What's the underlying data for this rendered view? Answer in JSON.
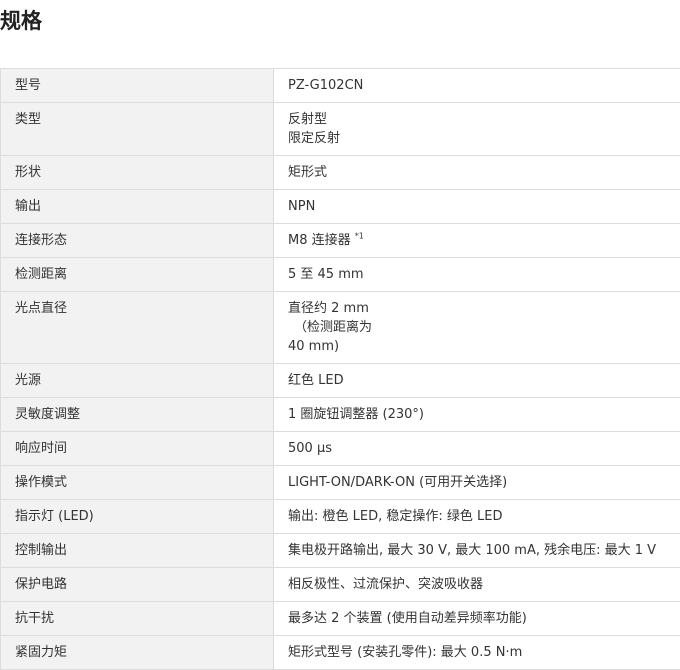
{
  "page": {
    "title": "规格"
  },
  "specs": [
    {
      "label": "型号",
      "value": "PZ-G102CN"
    },
    {
      "label": "类型",
      "lines": [
        "反射型",
        "限定反射"
      ]
    },
    {
      "label": "形状",
      "value": "矩形式"
    },
    {
      "label": "输出",
      "value": "NPN"
    },
    {
      "label": "连接形态",
      "value": "M8 连接器 ",
      "note": "*1"
    },
    {
      "label": "检测距离",
      "value": "5 至 45 mm"
    },
    {
      "label": "光点直径",
      "lines": [
        "直径约 2 mm",
        "（检测距离为",
        "40 mm)"
      ]
    },
    {
      "label": "光源",
      "value": "红色 LED"
    },
    {
      "label": "灵敏度调整",
      "value": "1 圈旋钮调整器 (230°)"
    },
    {
      "label": "响应时间",
      "value": "500 μs"
    },
    {
      "label": "操作模式",
      "value": "LIGHT-ON/DARK-ON (可用开关选择)"
    },
    {
      "label": "指示灯 (LED)",
      "value": "输出: 橙色 LED, 稳定操作: 绿色 LED"
    },
    {
      "label": "控制输出",
      "value": "集电极开路输出, 最大 30 V, 最大 100 mA, 残余电压: 最大 1 V"
    },
    {
      "label": "保护电路",
      "value": "相反极性、过流保护、突波吸收器"
    },
    {
      "label": "抗干扰",
      "value": "最多达 2 个装置 (使用自动差异频率功能)"
    },
    {
      "label": "紧固力矩",
      "value": "矩形式型号 (安装孔零件): 最大 0.5 N·m"
    }
  ]
}
